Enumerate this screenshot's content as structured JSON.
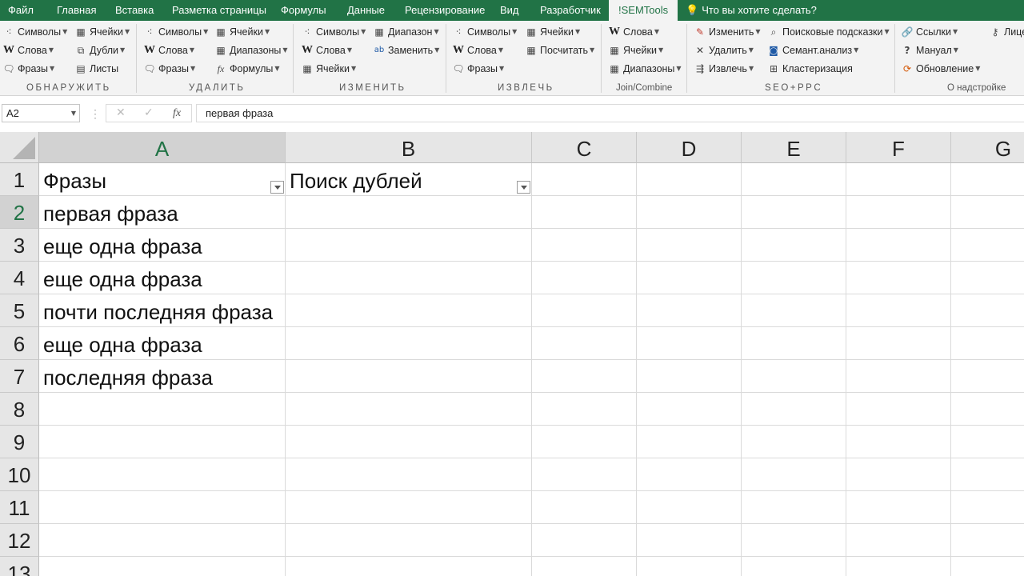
{
  "menu": {
    "tabs": [
      "Файл",
      "Главная",
      "Вставка",
      "Разметка страницы",
      "Формулы",
      "Данные",
      "Рецензирование",
      "Вид",
      "Разработчик",
      "!SEMTools"
    ],
    "help": "Что вы хотите сделать?"
  },
  "ribbon": {
    "discover": {
      "group": "ОБНАРУЖИТЬ",
      "symbols": "Символы",
      "words": "Слова",
      "phrases": "Фразы",
      "cells": "Ячейки",
      "dupes": "Дубли",
      "sheets": "Листы"
    },
    "remove": {
      "group": "УДАЛИТЬ",
      "symbols": "Символы",
      "words": "Слова",
      "phrases": "Фразы",
      "cells": "Ячейки",
      "ranges": "Диапазоны",
      "formulas": "Формулы"
    },
    "change": {
      "group": "ИЗМЕНИТЬ",
      "symbols": "Символы",
      "words": "Слова",
      "cells": "Ячейки",
      "range": "Диапазон",
      "replace": "Заменить"
    },
    "extract": {
      "group": "ИЗВЛЕЧЬ",
      "symbols": "Символы",
      "words": "Слова",
      "phrases": "Фразы",
      "cells": "Ячейки",
      "count": "Посчитать"
    },
    "join": {
      "group": "Join/Combine",
      "words": "Слова",
      "cells": "Ячейки",
      "ranges": "Диапазоны"
    },
    "seo": {
      "group": "SEO+PPC",
      "modify": "Изменить",
      "delete": "Удалить",
      "extract": "Извлечь",
      "suggest": "Поисковые подсказки",
      "semant": "Семант.анализ",
      "cluster": "Кластеризация"
    },
    "about": {
      "group": "О надстройке",
      "links": "Ссылки",
      "manual": "Мануал",
      "update": "Обновление",
      "license": "Лице"
    }
  },
  "formula_bar": {
    "name_box": "A2",
    "cancel": "✕",
    "enter": "✓",
    "fx": "fx",
    "content": "первая фраза"
  },
  "grid": {
    "columns": [
      "A",
      "B",
      "C",
      "D",
      "E",
      "F",
      "G"
    ],
    "rows": [
      "1",
      "2",
      "3",
      "4",
      "5",
      "6",
      "7",
      "8",
      "9",
      "10",
      "11",
      "12",
      "13"
    ],
    "header_a": "Фразы",
    "header_b": "Поиск дублей",
    "cells_a": [
      "первая фраза",
      "еще одна фраза",
      "еще одна фраза",
      "почти последняя фраза",
      "еще одна фраза",
      "последняя фраза"
    ],
    "selected_cell": "A2"
  },
  "colors": {
    "accent": "#217346",
    "ribbon_bg": "#f3f3f3",
    "header_bg": "#e6e6e6"
  }
}
